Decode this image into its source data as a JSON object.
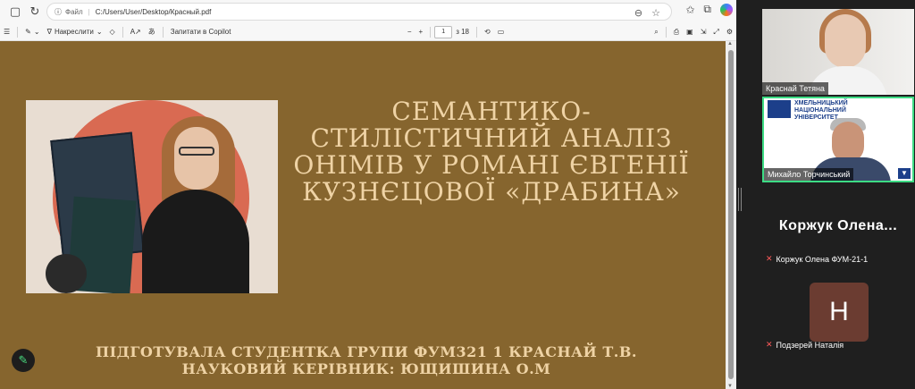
{
  "browser": {
    "back_icon": "←",
    "refresh_icon": "↻",
    "scheme_label": "Файл",
    "url": "C:/Users/User/Desktop/Красный.pdf"
  },
  "pdf_toolbar": {
    "draw_label": "Накреслити",
    "copilot_label": "Запитати в Copilot",
    "zoom_minus": "−",
    "zoom_plus": "+",
    "page_current": "1",
    "page_total": "з 18"
  },
  "slide": {
    "title": "СЕМАНТИКО-СТИЛІСТИЧНИЙ АНАЛІЗ ОНІМІВ У РОМАНІ ЄВГЕНІЇ КУЗНЄЦОВОЇ «ДРАБИНА»",
    "subtitle_line1": "ПІДГОТУВАЛА СТУДЕНТКА ГРУПИ ФУМ321 1 КРАСНАЙ Т.В.",
    "subtitle_line2": "НАУКОВИЙ КЕРІВНИК: ЮЩИШИНА О.М"
  },
  "participants": {
    "tile1_name": "Краснай Тетяна",
    "tile2_name": "Михайло Торчинський",
    "tile2_org": "ХМЕЛЬНИЦЬКИЙ НАЦІОНАЛЬНИЙ УНІВЕРСИТЕТ",
    "big_name": "Коржук  Олена...",
    "korzhuk_full": "Коржук Олена ФУМ-21-1",
    "avatar_letter": "Н",
    "podzerei_name": "Подзерей Наталія"
  }
}
